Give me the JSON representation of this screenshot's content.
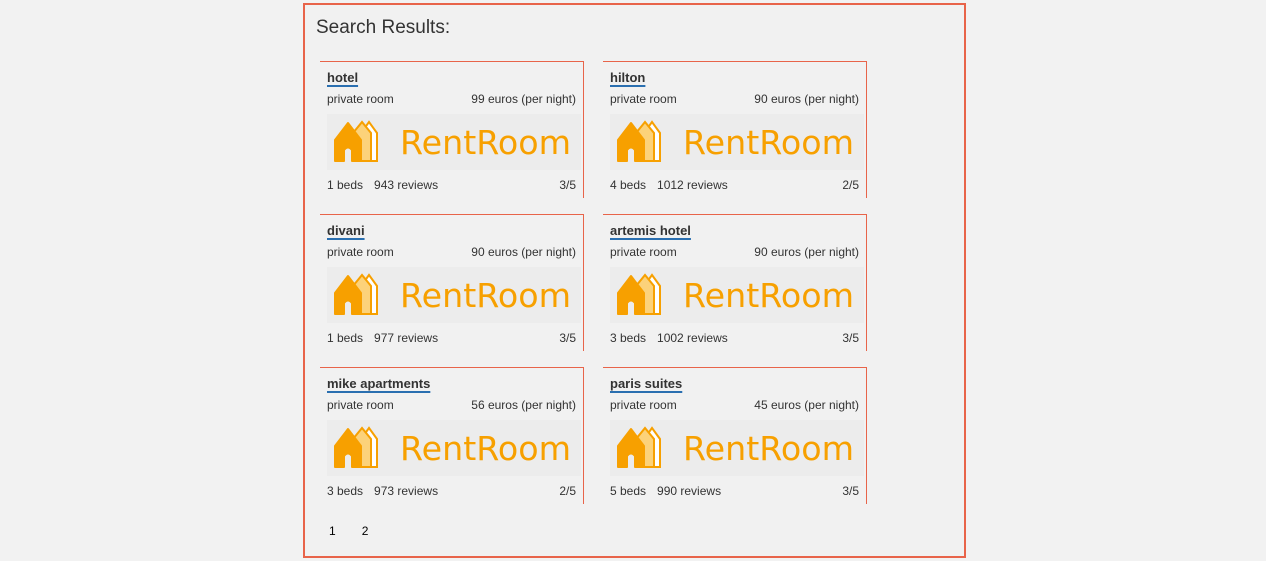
{
  "heading": "Search Results:",
  "brand": {
    "text": "RentRoom",
    "color": "#f7a000"
  },
  "listings": [
    {
      "name": "hotel",
      "room_type": "private room",
      "price": "99 euros (per night)",
      "beds": "1 beds",
      "reviews": "943 reviews",
      "rating": "3/5"
    },
    {
      "name": "hilton",
      "room_type": "private room",
      "price": "90 euros (per night)",
      "beds": "4 beds",
      "reviews": "1012 reviews",
      "rating": "2/5"
    },
    {
      "name": "divani",
      "room_type": "private room",
      "price": "90 euros (per night)",
      "beds": "1 beds",
      "reviews": "977 reviews",
      "rating": "3/5"
    },
    {
      "name": "artemis hotel",
      "room_type": "private room",
      "price": "90 euros (per night)",
      "beds": "3 beds",
      "reviews": "1002 reviews",
      "rating": "3/5"
    },
    {
      "name": "mike apartments",
      "room_type": "private room",
      "price": "56 euros (per night)",
      "beds": "3 beds",
      "reviews": "973 reviews",
      "rating": "2/5"
    },
    {
      "name": "paris suites",
      "room_type": "private room",
      "price": "45 euros (per night)",
      "beds": "5 beds",
      "reviews": "990 reviews",
      "rating": "3/5"
    }
  ],
  "pagination": [
    "1",
    "2"
  ],
  "colors": {
    "border": "#e8644a",
    "link_underline": "#2a6fb0"
  }
}
